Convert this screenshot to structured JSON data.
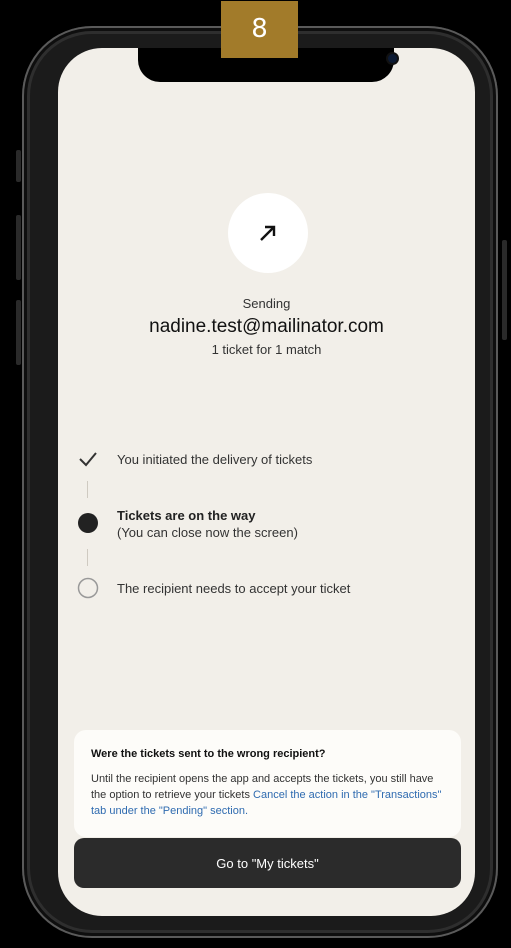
{
  "step_badge": "8",
  "status": {
    "heading": "Sending",
    "recipient_email": "nadine.test@mailinator.com",
    "summary": "1 ticket for 1 match",
    "icon": "arrow-up-right-icon"
  },
  "steps": [
    {
      "state": "done",
      "icon": "checkmark-icon",
      "text": "You initiated the delivery of tickets"
    },
    {
      "state": "current",
      "icon": "filled-dot-icon",
      "title": "Tickets are on the way",
      "subtitle": "(You can close now the screen)"
    },
    {
      "state": "pending",
      "icon": "empty-circle-icon",
      "text": "The recipient needs to accept your ticket"
    }
  ],
  "info_card": {
    "title": "Were the tickets sent to the wrong recipient?",
    "body": "Until the recipient opens the app and accepts the tickets, you still have the option to retrieve your tickets",
    "link": "Cancel the action in the \"Transactions\" tab under the \"Pending\" section."
  },
  "cta": {
    "label": "Go to \"My tickets\""
  },
  "colors": {
    "background": "#f2efe9",
    "button": "#2b2b2b",
    "link": "#2f6bb0",
    "badge": "#a27b2a"
  }
}
